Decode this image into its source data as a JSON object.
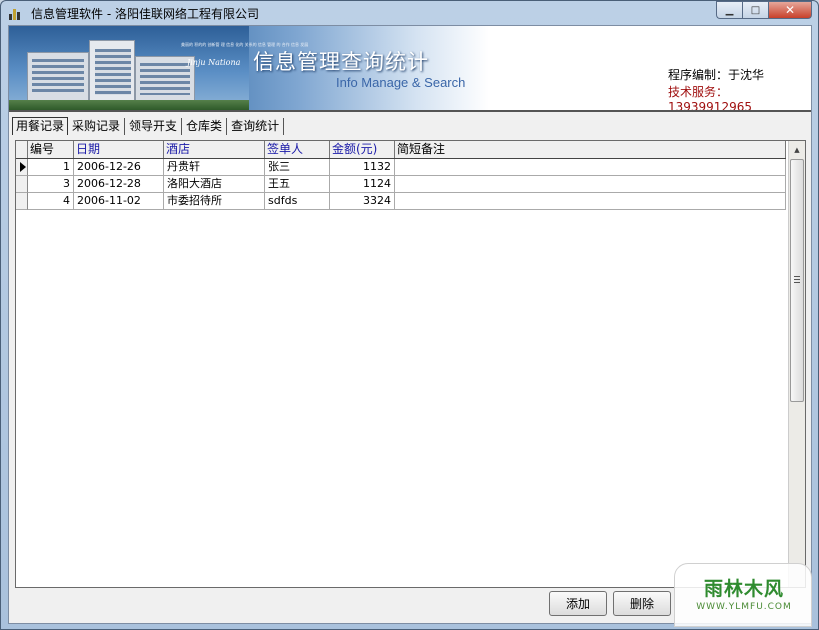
{
  "window": {
    "title": "信息管理软件 - 洛阳佳联网络工程有限公司",
    "min_label": "▁",
    "max_label": "□",
    "close_label": "✕"
  },
  "banner": {
    "small_text": "美丽的 积的的 创新管 理 信息 化的 关系的 信息 管理 的 合作 信息 发展",
    "brand_text": "Jinju Nationa",
    "title": "信息管理查询统计",
    "subtitle": "Info Manage & Search",
    "author": "程序编制：于沈华",
    "support": "技术服务：13939912965"
  },
  "tabs": [
    {
      "label": "用餐记录",
      "active": true
    },
    {
      "label": "采购记录",
      "active": false
    },
    {
      "label": "领导开支",
      "active": false
    },
    {
      "label": "仓库类",
      "active": false
    },
    {
      "label": "查询统计",
      "active": false
    }
  ],
  "grid": {
    "headers": {
      "id": "编号",
      "date": "日期",
      "hotel": "酒店",
      "signer": "签单人",
      "amount": "金额(元)",
      "note": "简短备注"
    },
    "rows": [
      {
        "id": "1",
        "date": "2006-12-26",
        "hotel": "丹贵轩",
        "signer": "张三",
        "amount": "1132",
        "note": ""
      },
      {
        "id": "3",
        "date": "2006-12-28",
        "hotel": "洛阳大酒店",
        "signer": "王五",
        "amount": "1124",
        "note": ""
      },
      {
        "id": "4",
        "date": "2006-11-02",
        "hotel": "市委招待所",
        "signer": "sdfds",
        "amount": "3324",
        "note": ""
      }
    ]
  },
  "buttons": {
    "add": "添加",
    "delete": "删除"
  },
  "watermark": {
    "main": "雨林木风",
    "sub": "WWW.YLMFU.COM"
  }
}
